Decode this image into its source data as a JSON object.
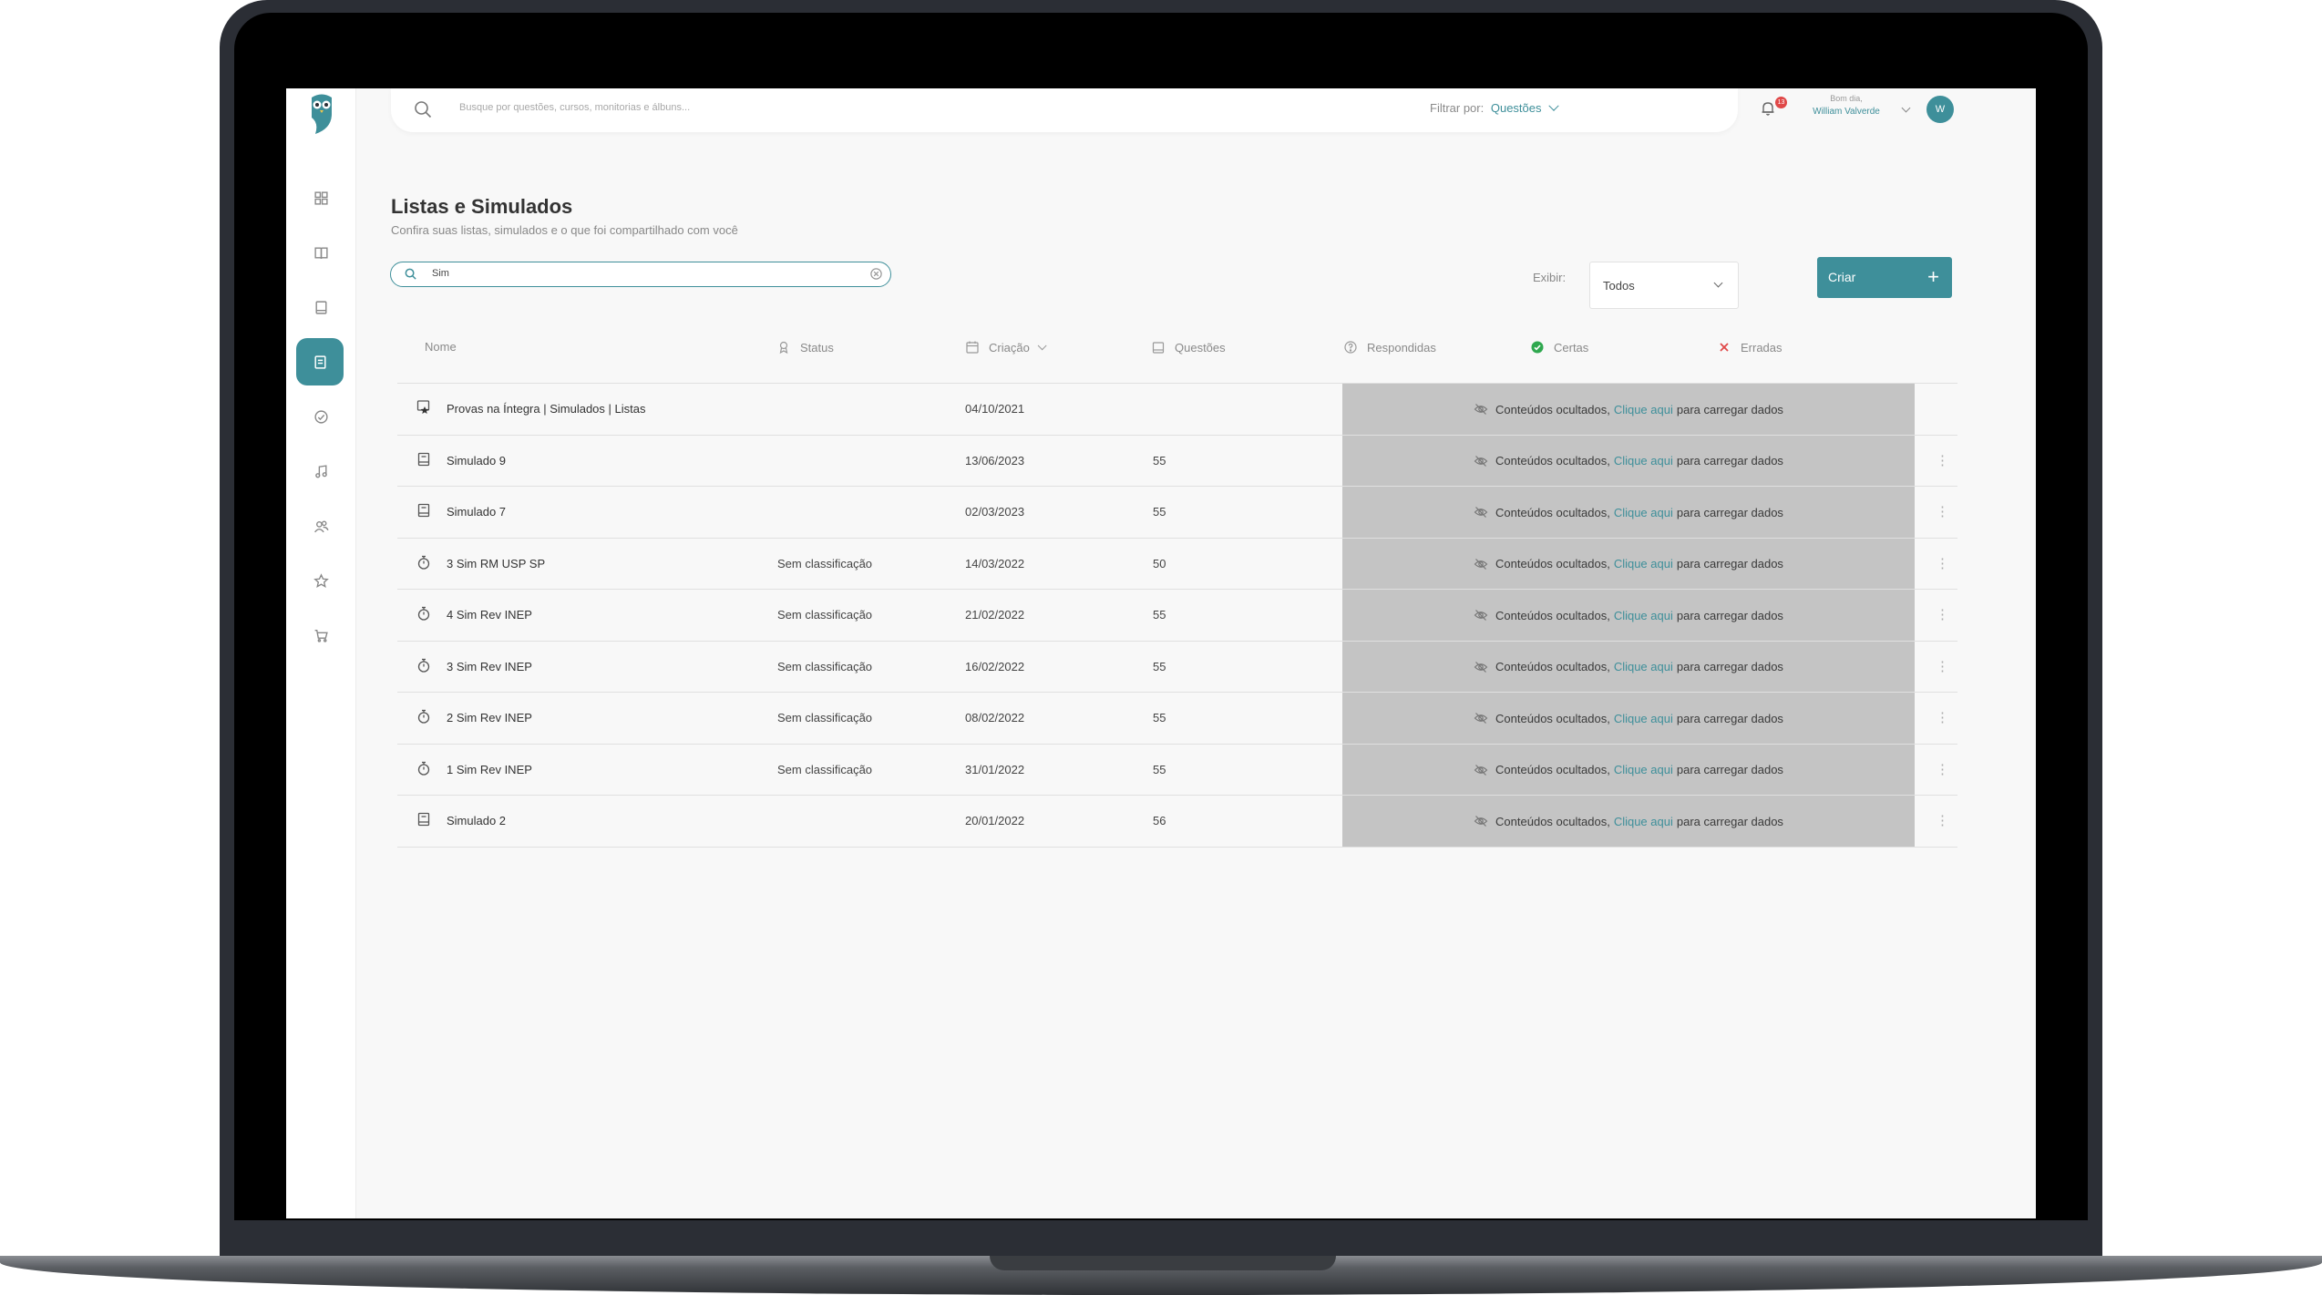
{
  "colors": {
    "accent": "#3e8f9a",
    "hidden_bg": "#c4c4c4",
    "badge": "#e04848",
    "check": "#2fa84f",
    "cross": "#e04848"
  },
  "header": {
    "search_placeholder": "Busque por questões, cursos, monitorias e álbuns...",
    "filter_label": "Filtrar por:",
    "filter_value": "Questões",
    "notification_count": "13",
    "greeting": "Bom dia,",
    "user_name": "William Valverde",
    "avatar_initial": "W"
  },
  "sidebar": {
    "items": [
      {
        "icon": "dashboard-icon"
      },
      {
        "icon": "book-open-icon"
      },
      {
        "icon": "book-icon"
      },
      {
        "icon": "lists-icon",
        "active": true
      },
      {
        "icon": "check-circle-icon"
      },
      {
        "icon": "music-icon"
      },
      {
        "icon": "users-icon"
      },
      {
        "icon": "star-icon"
      },
      {
        "icon": "cart-icon"
      }
    ]
  },
  "page": {
    "title": "Listas e Simulados",
    "subtitle": "Confira suas listas, simulados e o que foi compartilhado com você",
    "search_value": "Sim",
    "exibir_label": "Exibir:",
    "exibir_value": "Todos",
    "create_label": "Criar",
    "create_plus": "+"
  },
  "table": {
    "columns": {
      "nome": "Nome",
      "status": "Status",
      "criacao": "Criação",
      "questoes": "Questões",
      "respondidas": "Respondidas",
      "certas": "Certas",
      "erradas": "Erradas"
    },
    "hidden_text": {
      "prefix": "Conteúdos ocultados,",
      "link": "Clique aqui",
      "suffix": "para carregar dados"
    },
    "more_glyph": "⋮",
    "rows": [
      {
        "icon": "star-document-icon",
        "name": "Provas na Íntegra | Simulados | Listas",
        "status": "",
        "date": "04/10/2021",
        "questions": "",
        "menu": false
      },
      {
        "icon": "document-icon",
        "name": "Simulado 9",
        "status": "",
        "date": "13/06/2023",
        "questions": "55",
        "menu": true
      },
      {
        "icon": "document-icon",
        "name": "Simulado 7",
        "status": "",
        "date": "02/03/2023",
        "questions": "55",
        "menu": true
      },
      {
        "icon": "stopwatch-icon",
        "name": "3 Sim RM USP SP",
        "status": "Sem classificação",
        "date": "14/03/2022",
        "questions": "50",
        "menu": true
      },
      {
        "icon": "stopwatch-icon",
        "name": "4 Sim Rev INEP",
        "status": "Sem classificação",
        "date": "21/02/2022",
        "questions": "55",
        "menu": true
      },
      {
        "icon": "stopwatch-icon",
        "name": "3 Sim Rev INEP",
        "status": "Sem classificação",
        "date": "16/02/2022",
        "questions": "55",
        "menu": true
      },
      {
        "icon": "stopwatch-icon",
        "name": "2 Sim Rev INEP",
        "status": "Sem classificação",
        "date": "08/02/2022",
        "questions": "55",
        "menu": true
      },
      {
        "icon": "stopwatch-icon",
        "name": "1 Sim Rev INEP",
        "status": "Sem classificação",
        "date": "31/01/2022",
        "questions": "55",
        "menu": true
      },
      {
        "icon": "document-icon",
        "name": "Simulado 2",
        "status": "",
        "date": "20/01/2022",
        "questions": "56",
        "menu": true
      }
    ]
  }
}
